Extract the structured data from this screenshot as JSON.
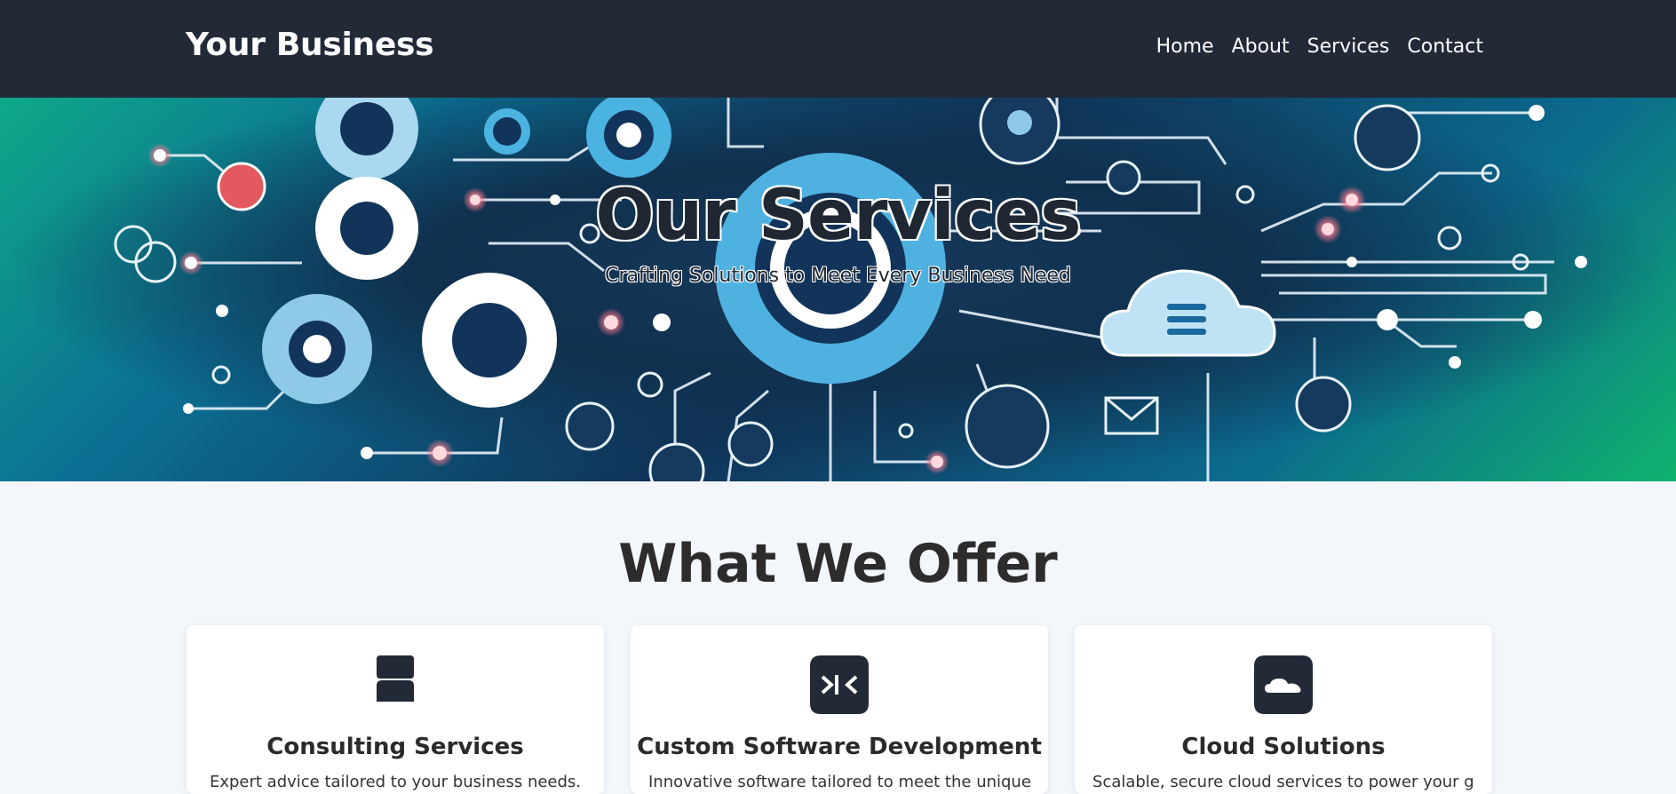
{
  "header": {
    "brand": "Your Business",
    "nav": [
      "Home",
      "About",
      "Services",
      "Contact"
    ]
  },
  "hero": {
    "title": "Our Services",
    "subtitle": "Crafting Solutions to Meet Every Business Need"
  },
  "offer": {
    "heading": "What We Offer",
    "cards": [
      {
        "icon": "user-tie-icon",
        "title": "Consulting Services",
        "text": "Expert advice tailored to your business needs."
      },
      {
        "icon": "code-icon",
        "title": "Custom Software Development",
        "text": "Innovative software tailored to meet the unique needs."
      },
      {
        "icon": "cloud-icon",
        "title": "Cloud Solutions",
        "text": "Scalable, secure cloud services to power your growth."
      }
    ]
  },
  "colors": {
    "header_bg": "#222a38",
    "page_bg": "#f3f6fa",
    "icon_dark": "#222a38"
  }
}
